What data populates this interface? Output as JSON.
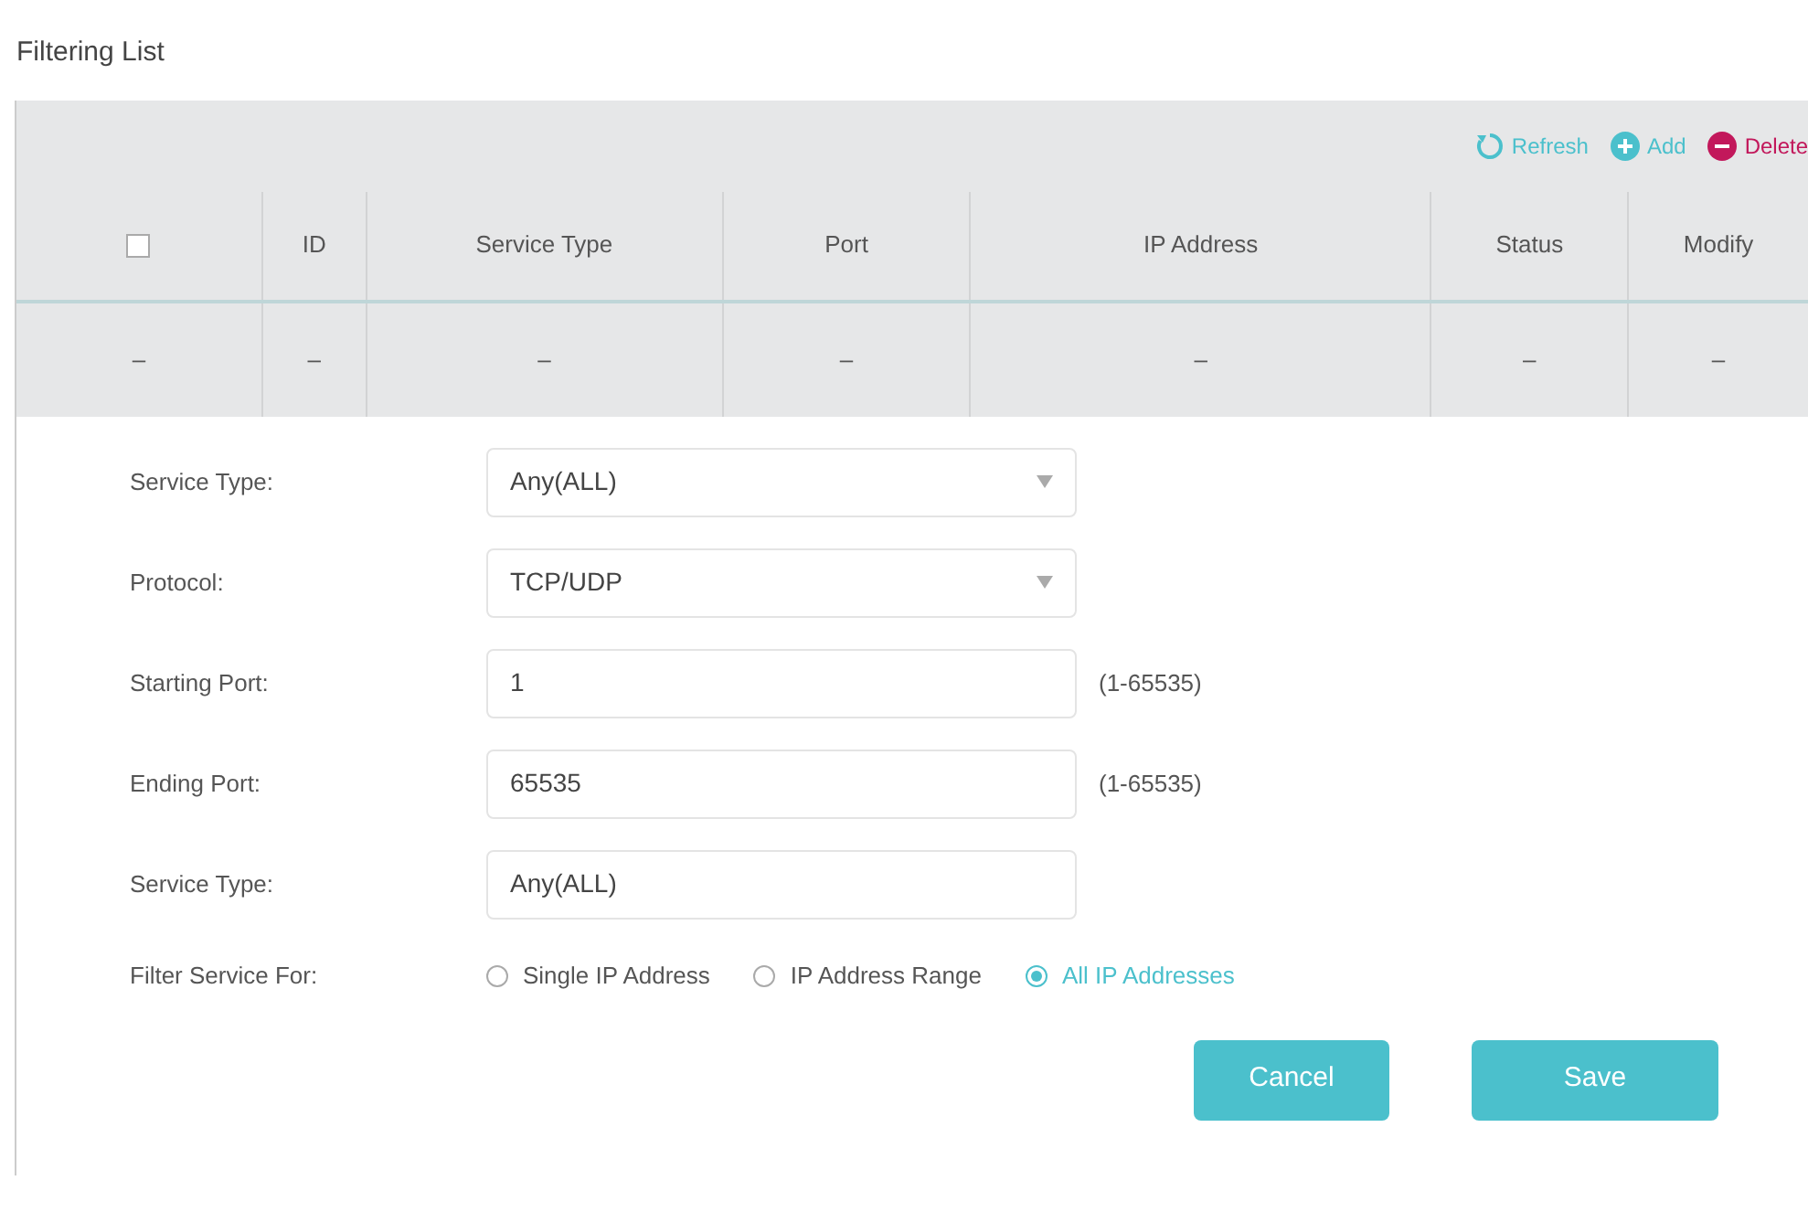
{
  "title": "Filtering List",
  "toolbar": [
    {
      "kind": "refresh",
      "label": "Refresh"
    },
    {
      "kind": "add",
      "label": "Add"
    },
    {
      "kind": "delete",
      "label": "Delete"
    }
  ],
  "table": {
    "columns": [
      {
        "kind": "checkbox",
        "checked": false
      },
      {
        "kind": "text",
        "label": "ID"
      },
      {
        "kind": "text",
        "label": "Service Type"
      },
      {
        "kind": "text",
        "label": "Port"
      },
      {
        "kind": "text",
        "label": "IP Address"
      },
      {
        "kind": "text",
        "label": "Status"
      },
      {
        "kind": "text",
        "label": "Modify"
      }
    ],
    "rows": [
      {
        "cells": [
          "–",
          "–",
          "–",
          "–",
          "–",
          "–",
          "–"
        ]
      }
    ]
  },
  "form": {
    "fields": [
      {
        "kind": "select",
        "label": "Service Type:",
        "value": "Any(ALL)"
      },
      {
        "kind": "select",
        "label": "Protocol:",
        "value": "TCP/UDP"
      },
      {
        "kind": "input",
        "label": "Starting Port:",
        "value": "1",
        "hint": "(1-65535)"
      },
      {
        "kind": "input",
        "label": "Ending Port:",
        "value": "65535",
        "hint": "(1-65535)"
      },
      {
        "kind": "input",
        "label": "Service Type:",
        "value": "Any(ALL)"
      }
    ],
    "filter": {
      "label": "Filter Service For:",
      "options": [
        {
          "label": "Single IP Address",
          "selected": false
        },
        {
          "label": "IP Address Range",
          "selected": false
        },
        {
          "label": "All IP Addresses",
          "selected": true
        }
      ]
    },
    "buttons": [
      "Cancel",
      "Save"
    ]
  }
}
